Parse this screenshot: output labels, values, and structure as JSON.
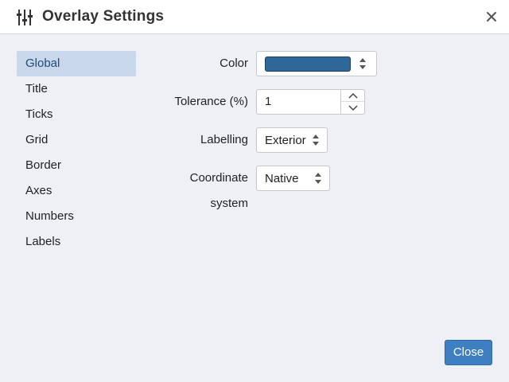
{
  "window": {
    "title": "Overlay Settings",
    "title_icon": "sliders-icon",
    "close_icon": "close-icon"
  },
  "sidebar": {
    "items": [
      {
        "label": "Global",
        "active": true
      },
      {
        "label": "Title"
      },
      {
        "label": "Ticks"
      },
      {
        "label": "Grid"
      },
      {
        "label": "Border"
      },
      {
        "label": "Axes"
      },
      {
        "label": "Numbers"
      },
      {
        "label": "Labels"
      }
    ]
  },
  "form": {
    "color": {
      "label": "Color",
      "value": "#2f6799"
    },
    "tolerance": {
      "label": "Tolerance (%)",
      "value": "1"
    },
    "labelling": {
      "label": "Labelling",
      "value": "Exterior"
    },
    "coordinate_system": {
      "label_line1": "Coordinate",
      "label_line2": "system",
      "value": "Native"
    }
  },
  "footer": {
    "close_label": "Close"
  },
  "colors": {
    "accent": "#3d7fc1",
    "sidebar_active_bg": "#c8d8ea",
    "sidebar_active_text": "#1e4b78"
  }
}
